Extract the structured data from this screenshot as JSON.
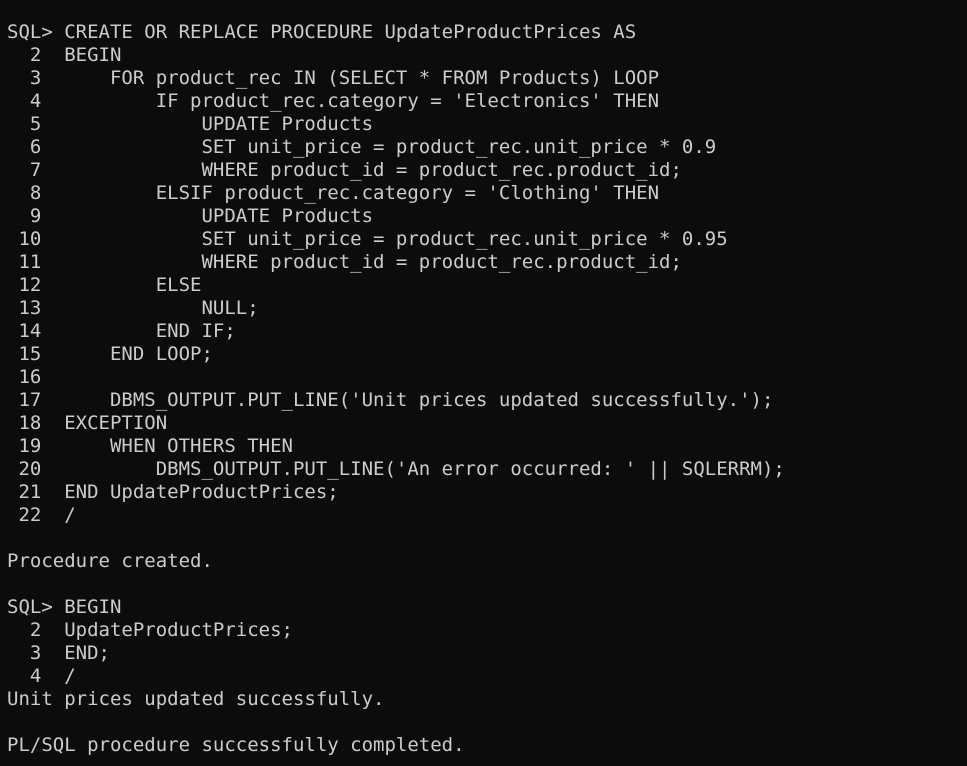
{
  "terminal": {
    "lines": [
      "SQL> CREATE OR REPLACE PROCEDURE UpdateProductPrices AS",
      "  2  BEGIN",
      "  3      FOR product_rec IN (SELECT * FROM Products) LOOP",
      "  4          IF product_rec.category = 'Electronics' THEN",
      "  5              UPDATE Products",
      "  6              SET unit_price = product_rec.unit_price * 0.9",
      "  7              WHERE product_id = product_rec.product_id;",
      "  8          ELSIF product_rec.category = 'Clothing' THEN",
      "  9              UPDATE Products",
      " 10              SET unit_price = product_rec.unit_price * 0.95",
      " 11              WHERE product_id = product_rec.product_id;",
      " 12          ELSE",
      " 13              NULL;",
      " 14          END IF;",
      " 15      END LOOP;",
      " 16",
      " 17      DBMS_OUTPUT.PUT_LINE('Unit prices updated successfully.');",
      " 18  EXCEPTION",
      " 19      WHEN OTHERS THEN",
      " 20          DBMS_OUTPUT.PUT_LINE('An error occurred: ' || SQLERRM);",
      " 21  END UpdateProductPrices;",
      " 22  /",
      "",
      "Procedure created.",
      "",
      "SQL> BEGIN",
      "  2  UpdateProductPrices;",
      "  3  END;",
      "  4  /",
      "Unit prices updated successfully.",
      "",
      "PL/SQL procedure successfully completed."
    ]
  }
}
